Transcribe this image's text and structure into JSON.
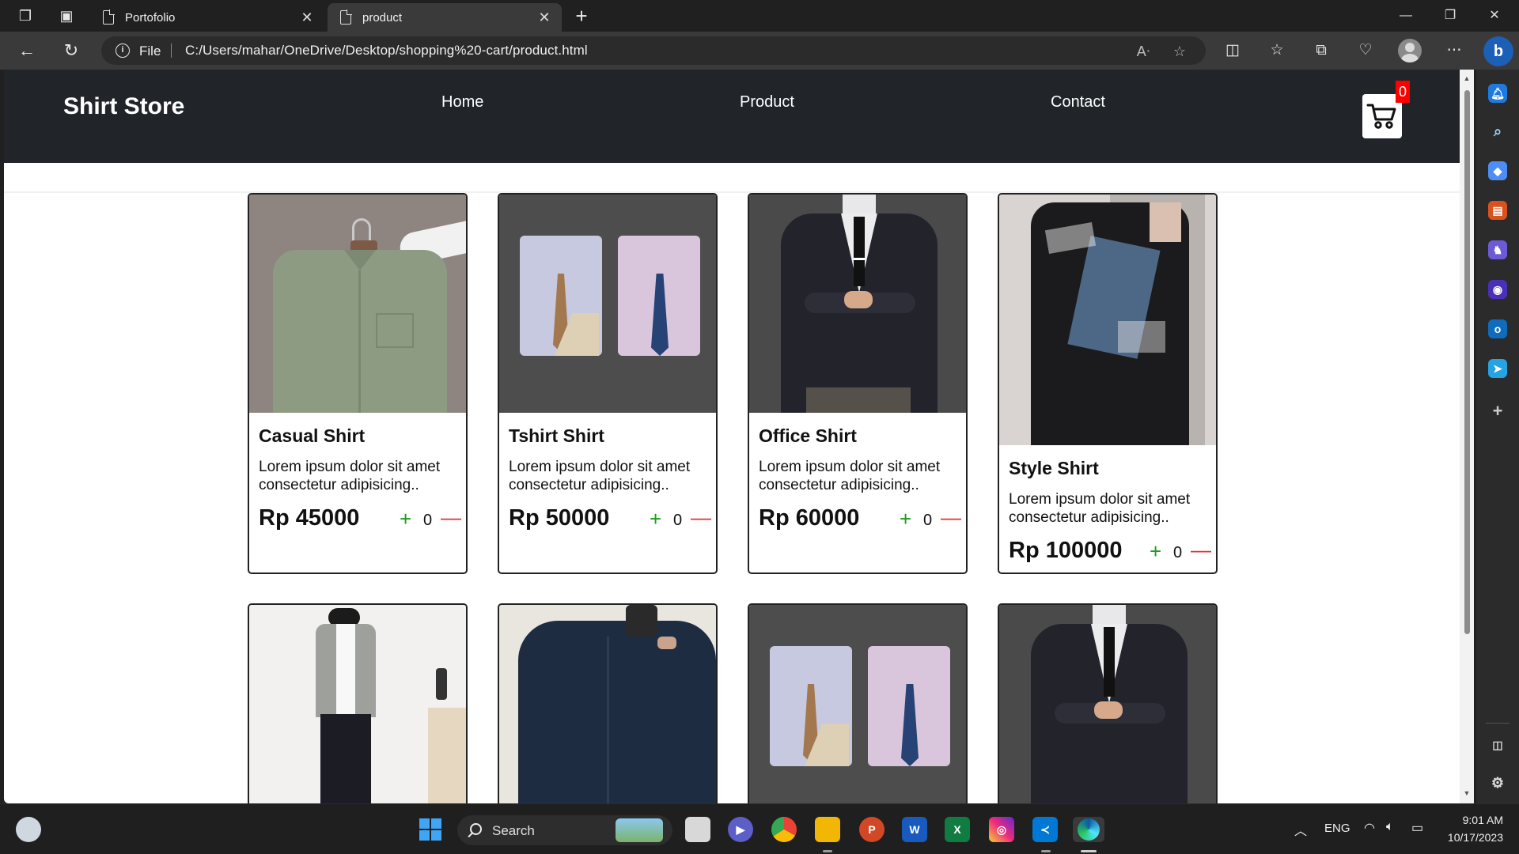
{
  "browser": {
    "tabs": [
      {
        "title": "Portofolio"
      },
      {
        "title": "product"
      }
    ],
    "address": {
      "scheme_label": "File",
      "url": "C:/Users/mahar/OneDrive/Desktop/shopping%20-cart/product.html"
    }
  },
  "site": {
    "brand": "Shirt Store",
    "nav": [
      "Home",
      "Product",
      "Contact"
    ],
    "cart_count": "0",
    "products": [
      {
        "name": "Casual Shirt",
        "description": "Lorem ipsum dolor sit amet consectetur adipisicing..",
        "price": "Rp 45000",
        "qty": "0",
        "plus": "+",
        "minus": "—"
      },
      {
        "name": "Tshirt Shirt",
        "description": "Lorem ipsum dolor sit amet consectetur adipisicing..",
        "price": "Rp 50000",
        "qty": "0",
        "plus": "+",
        "minus": "—"
      },
      {
        "name": "Office Shirt",
        "description": "Lorem ipsum dolor sit amet consectetur adipisicing..",
        "price": "Rp 60000",
        "qty": "0",
        "plus": "+",
        "minus": "—"
      },
      {
        "name": "Style Shirt",
        "description": "Lorem ipsum dolor sit amet consectetur adipisicing..",
        "price": "Rp 100000",
        "qty": "0",
        "plus": "+",
        "minus": "—"
      }
    ]
  },
  "taskbar": {
    "search_label": "Search",
    "language": "ENG",
    "time": "9:01 AM",
    "date": "10/17/2023"
  },
  "colors": {
    "header_bg": "#212529",
    "plus": "#1a9e1a",
    "minus": "#e53030",
    "badge": "#ff0000"
  }
}
